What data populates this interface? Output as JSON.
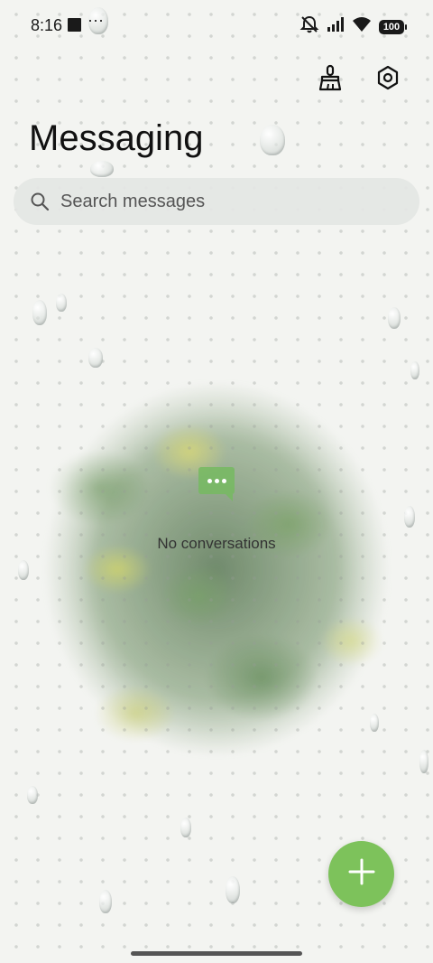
{
  "status_bar": {
    "time": "8:16",
    "more_indicator": "···",
    "battery": "100",
    "icons": [
      "stop-icon",
      "notifications-muted-icon",
      "signal-icon",
      "wifi-icon",
      "battery-icon"
    ]
  },
  "toolbar": {
    "clean_icon": "broom-icon",
    "settings_icon": "settings-icon"
  },
  "header": {
    "title": "Messaging"
  },
  "search": {
    "placeholder": "Search messages"
  },
  "empty_state": {
    "icon": "chat-bubble-icon",
    "text": "No conversations"
  },
  "fab": {
    "icon": "plus-icon"
  },
  "colors": {
    "accent": "#7dc25b",
    "text": "#111111"
  }
}
